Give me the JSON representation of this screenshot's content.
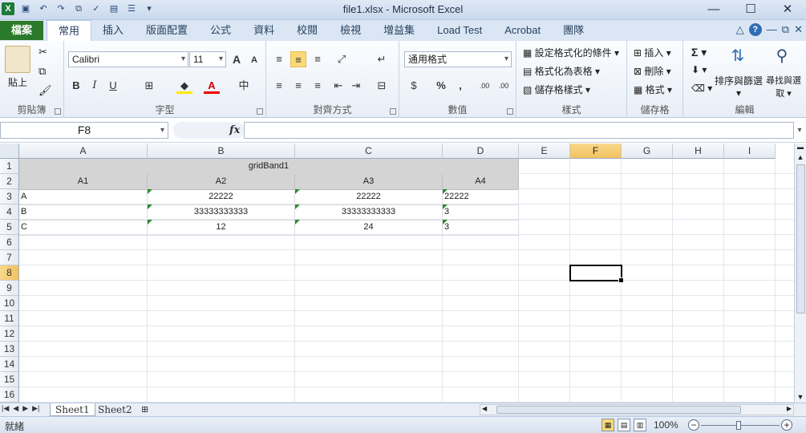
{
  "window": {
    "title": "file1.xlsx - Microsoft Excel"
  },
  "ribbon_tabs": {
    "file": "檔案",
    "items": [
      "常用",
      "插入",
      "版面配置",
      "公式",
      "資料",
      "校閱",
      "檢視",
      "增益集",
      "Load Test",
      "Acrobat",
      "團隊"
    ],
    "active_index": 0
  },
  "ribbon": {
    "clipboard": {
      "label": "剪貼簿",
      "paste": "貼上"
    },
    "font": {
      "label": "字型",
      "name": "Calibri",
      "size": "11",
      "bold": "B",
      "italic": "I",
      "underline": "U",
      "grow": "A",
      "shrink": "A"
    },
    "alignment": {
      "label": "對齊方式"
    },
    "number": {
      "label": "數值",
      "format": "通用格式",
      "percent": "%",
      "comma": ",",
      "inc_decimal": ".00",
      "dec_decimal": ".00"
    },
    "styles": {
      "label": "樣式",
      "conditional": "設定格式化的條件",
      "as_table": "格式化為表格",
      "cell_styles": "儲存格樣式"
    },
    "cells": {
      "label": "儲存格",
      "insert": "插入",
      "delete": "刪除",
      "format": "格式"
    },
    "editing": {
      "label": "編輯",
      "sort_filter": "排序與篩選",
      "find_select": "尋找與選取",
      "sum": "Σ"
    }
  },
  "formula_bar": {
    "name_box": "F8",
    "fx": "fx",
    "value": ""
  },
  "columns": [
    "A",
    "B",
    "C",
    "D",
    "E",
    "F",
    "G",
    "H",
    "I"
  ],
  "selected_column": "F",
  "rows": [
    "1",
    "2",
    "3",
    "4",
    "5",
    "6",
    "7",
    "8",
    "9",
    "10",
    "11",
    "12",
    "13",
    "14",
    "15",
    "16"
  ],
  "selected_row": "8",
  "cells": {
    "band": "gridBand1",
    "headers": [
      "A1",
      "A2",
      "A3",
      "A4"
    ],
    "data": [
      [
        "A",
        "22222",
        "22222",
        "22222"
      ],
      [
        "B",
        "33333333333",
        "33333333333",
        "3"
      ],
      [
        "C",
        "12",
        "24",
        "3"
      ]
    ]
  },
  "sheets": [
    "Sheet1",
    "Sheet2"
  ],
  "active_sheet": "Sheet1",
  "status": {
    "ready": "就緒",
    "zoom": "100%"
  }
}
